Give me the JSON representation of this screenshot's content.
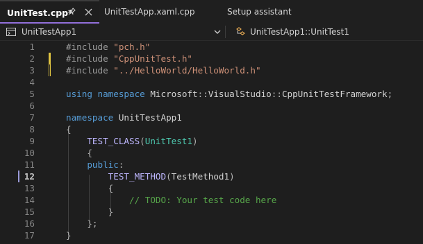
{
  "tabs": [
    {
      "label": "UnitTest.cpp*",
      "active": true
    },
    {
      "label": "UnitTestApp.xaml.cpp",
      "active": false
    },
    {
      "label": "Setup assistant",
      "active": false
    }
  ],
  "navbar": {
    "project": "UnitTestApp1",
    "scope": "UnitTestApp1::UnitTest1"
  },
  "icons": {
    "pin": "pin-icon",
    "close": "close-icon",
    "project": "project-icon",
    "class": "class-icon",
    "dropdown": "chevron-down-icon"
  },
  "colors": {
    "accent": "#9370db",
    "keyword": "#569cd6",
    "string": "#ce9178",
    "macro": "#beb7ff",
    "type": "#4ec9b0",
    "comment": "#57a64a",
    "change_marker": "#e1c542"
  },
  "editor": {
    "current_line": 12,
    "lines": [
      {
        "n": "1",
        "tokens": [
          [
            "pp",
            "#include "
          ],
          [
            "str",
            "\"pch.h\""
          ]
        ]
      },
      {
        "n": "2",
        "tokens": [
          [
            "pp",
            "#include "
          ],
          [
            "str",
            "\"CppUnitTest.h\""
          ]
        ]
      },
      {
        "n": "3",
        "tokens": [
          [
            "pp",
            "#include "
          ],
          [
            "str",
            "\"../HelloWorld/HelloWorld.h\""
          ]
        ]
      },
      {
        "n": "4",
        "tokens": []
      },
      {
        "n": "5",
        "tokens": [
          [
            "kw",
            "using"
          ],
          [
            "ident",
            " "
          ],
          [
            "kw",
            "namespace"
          ],
          [
            "ident",
            " Microsoft"
          ],
          [
            "punc",
            "::"
          ],
          [
            "ident",
            "VisualStudio"
          ],
          [
            "punc",
            "::"
          ],
          [
            "ident",
            "CppUnitTestFramework"
          ],
          [
            "punc",
            ";"
          ]
        ]
      },
      {
        "n": "6",
        "tokens": []
      },
      {
        "n": "7",
        "tokens": [
          [
            "kw",
            "namespace"
          ],
          [
            "ident",
            " UnitTestApp1"
          ]
        ]
      },
      {
        "n": "8",
        "tokens": [
          [
            "punc",
            "{"
          ]
        ]
      },
      {
        "n": "9",
        "tokens": [
          [
            "ident",
            "    "
          ],
          [
            "macro",
            "TEST_CLASS"
          ],
          [
            "punc",
            "("
          ],
          [
            "cls",
            "UnitTest1"
          ],
          [
            "punc",
            ")"
          ]
        ]
      },
      {
        "n": "10",
        "tokens": [
          [
            "ident",
            "    "
          ],
          [
            "punc",
            "{"
          ]
        ]
      },
      {
        "n": "11",
        "tokens": [
          [
            "ident",
            "    "
          ],
          [
            "kw",
            "public"
          ],
          [
            "punc",
            ":"
          ]
        ]
      },
      {
        "n": "12",
        "tokens": [
          [
            "ident",
            "        "
          ],
          [
            "macro",
            "TEST_METHOD"
          ],
          [
            "punc",
            "("
          ],
          [
            "ident",
            "TestMethod1"
          ],
          [
            "punc",
            ")"
          ]
        ]
      },
      {
        "n": "13",
        "tokens": [
          [
            "ident",
            "        "
          ],
          [
            "punc",
            "{"
          ]
        ]
      },
      {
        "n": "14",
        "tokens": [
          [
            "ident",
            "            "
          ],
          [
            "cmt",
            "// TODO: Your test code here"
          ]
        ]
      },
      {
        "n": "15",
        "tokens": [
          [
            "ident",
            "        "
          ],
          [
            "punc",
            "}"
          ]
        ]
      },
      {
        "n": "16",
        "tokens": [
          [
            "ident",
            "    "
          ],
          [
            "punc",
            "};"
          ]
        ]
      },
      {
        "n": "17",
        "tokens": [
          [
            "punc",
            "}"
          ]
        ]
      }
    ]
  }
}
